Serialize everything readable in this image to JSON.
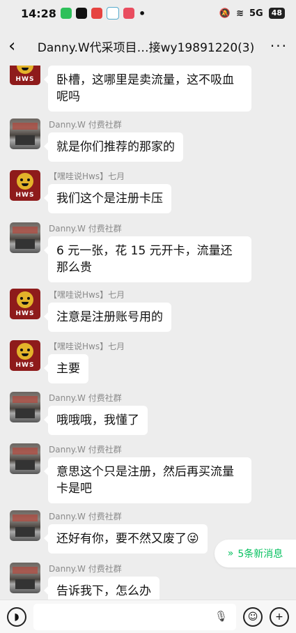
{
  "status_bar": {
    "time": "14:28",
    "signal": "5G",
    "battery": "48"
  },
  "header": {
    "back_icon": "chevron-left-icon",
    "title": "Danny.W代采项目…接wy19891220(3)",
    "more_icon": "more-dots-icon"
  },
  "messages": [
    {
      "sender": "",
      "avatar": "hws",
      "text": "卧槽，这哪里是卖流量，这不吸血呢吗"
    },
    {
      "sender": "Danny.W  付费社群",
      "avatar": "danny",
      "text": "就是你们推荐的那家的"
    },
    {
      "sender": "【嘿哇说Hws】七月",
      "avatar": "hws",
      "text": "我们这个是注册卡压"
    },
    {
      "sender": "Danny.W  付费社群",
      "avatar": "danny",
      "text": "6 元一张，花 15 元开卡，流量还那么贵"
    },
    {
      "sender": "【嘿哇说Hws】七月",
      "avatar": "hws",
      "text": "注意是注册账号用的"
    },
    {
      "sender": "【嘿哇说Hws】七月",
      "avatar": "hws",
      "text": "主要"
    },
    {
      "sender": "Danny.W  付费社群",
      "avatar": "danny",
      "text": "哦哦哦，我懂了"
    },
    {
      "sender": "Danny.W  付费社群",
      "avatar": "danny",
      "text": "意思这个只是注册，然后再买流量卡是吧"
    },
    {
      "sender": "Danny.W  付费社群",
      "avatar": "danny",
      "text": "还好有你，要不然又废了😜"
    },
    {
      "sender": "Danny.W  付费社群",
      "avatar": "danny",
      "text": "告诉我下，怎么办"
    }
  ],
  "avatar_label": "HWS",
  "new_messages": {
    "icon": "double-chevron-down-icon",
    "label": "5条新消息"
  },
  "input_bar": {
    "voice_icon": "voice-icon",
    "mic_icon": "mic-icon",
    "emoji_icon": "emoji-icon",
    "plus_icon": "plus-icon"
  },
  "colors": {
    "background": "#ededed",
    "bubble": "#ffffff",
    "accent": "#07c160"
  }
}
